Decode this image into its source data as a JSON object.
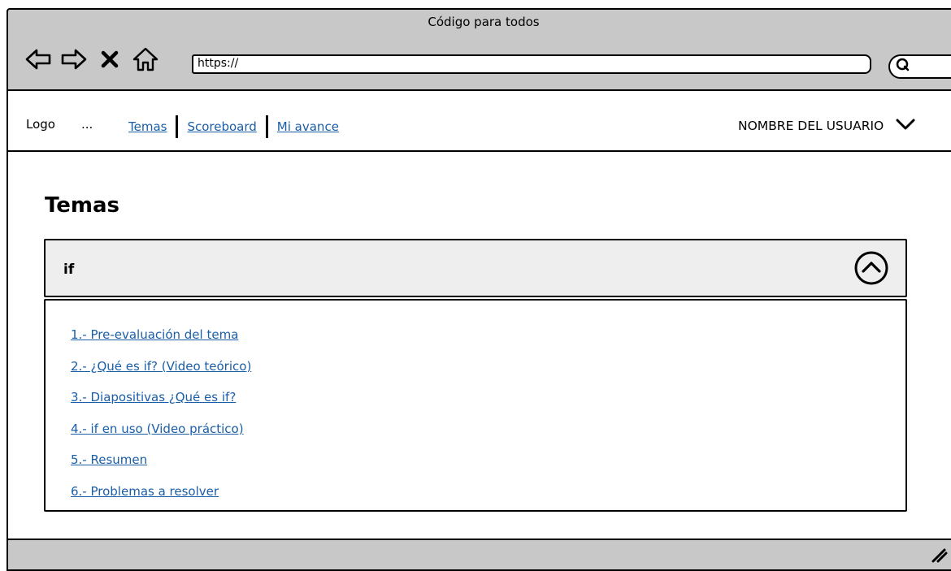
{
  "window": {
    "title": "Código para todos"
  },
  "browser": {
    "address_value": "https://",
    "icons": [
      "back-arrow-icon",
      "forward-arrow-icon",
      "close-x-icon",
      "home-icon",
      "search-icon"
    ]
  },
  "header": {
    "logo": "Logo",
    "ellipsis": "...",
    "nav": [
      {
        "label": "Temas"
      },
      {
        "label": "Scoreboard"
      },
      {
        "label": "Mi avance"
      }
    ],
    "user_name": "NOMBRE DEL USUARIO"
  },
  "main": {
    "title": "Temas",
    "accordion": {
      "title": "if",
      "items": [
        {
          "label": "1.- Pre-evaluación del tema"
        },
        {
          "label": "2.- ¿Qué es if? (Video teórico)"
        },
        {
          "label": "3.- Diapositivas ¿Qué es if?"
        },
        {
          "label": "4.- if en uso (Video práctico)"
        },
        {
          "label": "5.- Resumen"
        },
        {
          "label": "6.- Problemas a resolver"
        }
      ]
    }
  },
  "colors": {
    "link": "#1a5ea8",
    "chrome": "#c8c8c8",
    "accordion_header": "#eeeeee"
  }
}
